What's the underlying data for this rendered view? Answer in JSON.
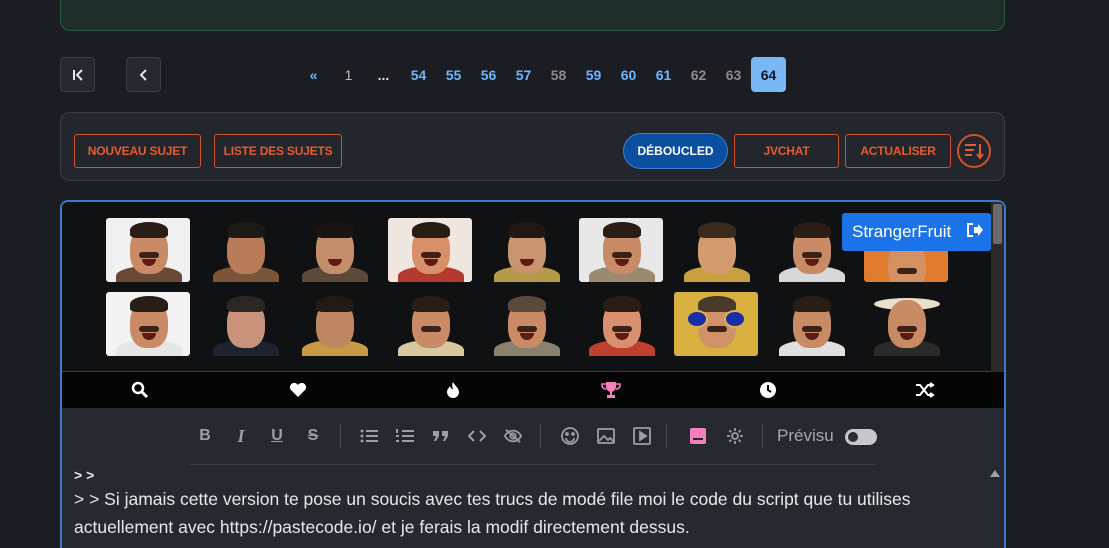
{
  "pagination": {
    "first_label": "K",
    "prev_label": "<",
    "pages": [
      "«",
      "1",
      "...",
      "54",
      "55",
      "56",
      "57",
      "58",
      "59",
      "60",
      "61",
      "62",
      "63",
      "64"
    ],
    "current": "64"
  },
  "actions": {
    "new_topic": "NOUVEAU SUJET",
    "topic_list": "LISTE DES SUJETS",
    "deboucled": "DÉBOUCLED",
    "jvchat": "JVCHAT",
    "refresh": "ACTUALISER",
    "sort_icon": "sort-descending-icon"
  },
  "sticker_panel": {
    "user_badge": "StrangerFruit",
    "categories": [
      "search-icon",
      "heart-icon",
      "fire-icon",
      "trophy-icon",
      "clock-icon",
      "shuffle-icon"
    ],
    "trophy_color": "#f57fbf"
  },
  "editor_toolbar": {
    "buttons": [
      "B",
      "I",
      "U",
      "S"
    ],
    "preview_label": "Prévisu"
  },
  "message": {
    "line0": "> >",
    "line1": "> > Si jamais cette version te pose un soucis avec tes trucs de modé file moi le code du script que tu utilises",
    "line2": "actuellement avec https://pastecode.io/ et je ferais la modif directement dessus."
  },
  "colors": {
    "accent_orange": "#e45c30",
    "link_blue": "#6fb4ff",
    "primary_blue": "#1a73e8"
  }
}
